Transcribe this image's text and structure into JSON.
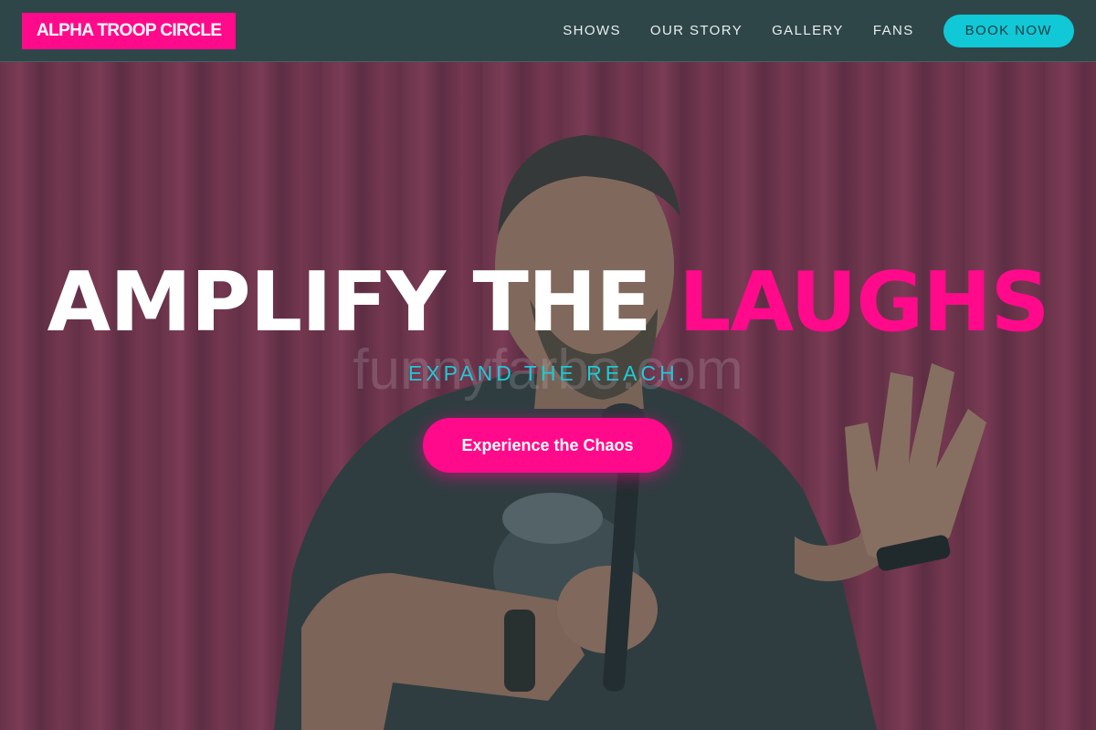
{
  "brand": {
    "logo_text": "ALPHA TROOP CIRCLE"
  },
  "nav": {
    "items": [
      {
        "label": "SHOWS"
      },
      {
        "label": "OUR STORY"
      },
      {
        "label": "GALLERY"
      },
      {
        "label": "FANS"
      }
    ],
    "book_label": "BOOK NOW"
  },
  "hero": {
    "title_part1": "AMPLIFY THE",
    "title_part2": "LAUGHS",
    "subtitle": "EXPAND THE REACH.",
    "watermark": "funnyfarbo.com",
    "cta_label": "Experience the Chaos",
    "image_description_icon": "comedian-photo"
  },
  "colors": {
    "accent_pink": "#ff0a8a",
    "accent_cyan": "#10c8d6",
    "header_bg": "#2f4649"
  }
}
